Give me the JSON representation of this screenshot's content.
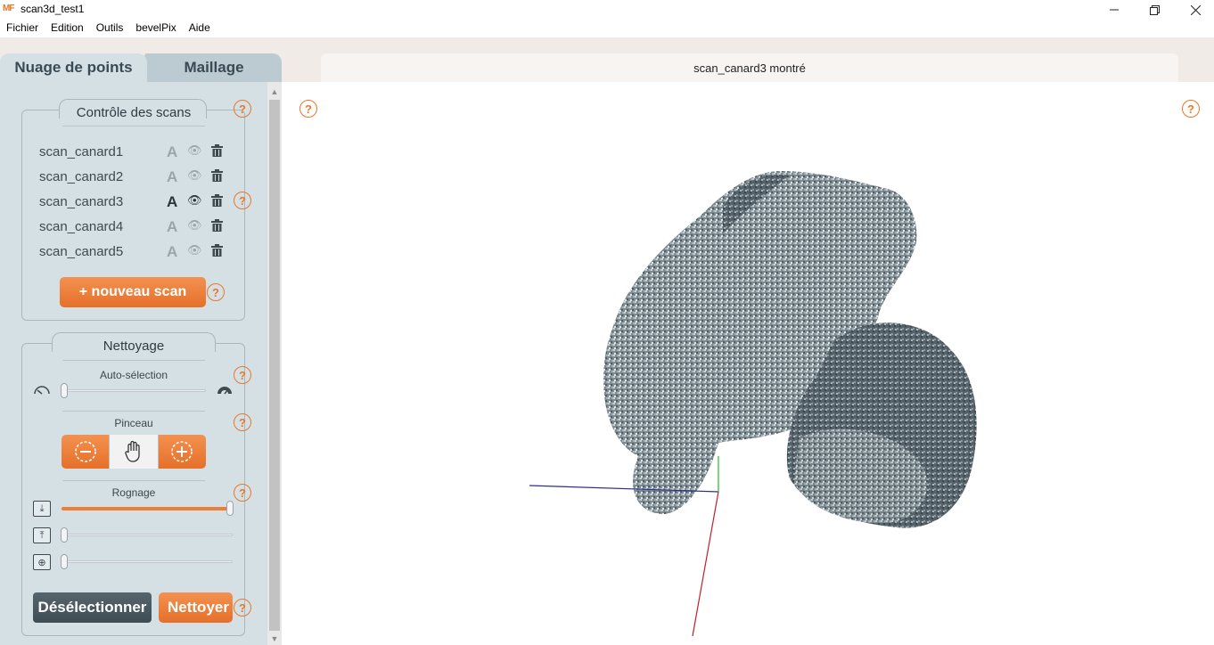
{
  "window": {
    "logo": "MF",
    "title": "scan3d_test1",
    "minimize_icon": "minimize-icon",
    "maximize_icon": "restore-icon",
    "close_icon": "close-icon"
  },
  "menu": {
    "items": [
      "Fichier",
      "Edition",
      "Outils",
      "bevelPix",
      "Aide"
    ]
  },
  "tabs": {
    "points": "Nuage de points",
    "maillage": "Maillage",
    "active": "Nuage de points"
  },
  "scan_control": {
    "title": "Contrôle des scans",
    "help": "?",
    "scans": [
      {
        "name": "scan_canard1",
        "label_icon": "A",
        "visible": false
      },
      {
        "name": "scan_canard2",
        "label_icon": "A",
        "visible": false
      },
      {
        "name": "scan_canard3",
        "label_icon": "A",
        "visible": true
      },
      {
        "name": "scan_canard4",
        "label_icon": "A",
        "visible": false
      },
      {
        "name": "scan_canard5",
        "label_icon": "A",
        "visible": false
      }
    ],
    "new_scan_label": "+ nouveau scan"
  },
  "cleaning": {
    "title": "Nettoyage",
    "auto_selection_label": "Auto-sélection",
    "auto_selection_value": 0,
    "brush_label": "Pinceau",
    "crop_label": "Rognage",
    "crop_top_value": 1.0,
    "crop_bottom_value": 0,
    "crop_radial_value": 0,
    "deselect_label": "Désélectionner",
    "clean_label": "Nettoyer"
  },
  "viewport": {
    "title": "scan_canard3 montré",
    "help": "?"
  },
  "colors": {
    "accent": "#ee7d35",
    "panel": "#d5e0e5",
    "dark_button": "#46545b"
  }
}
